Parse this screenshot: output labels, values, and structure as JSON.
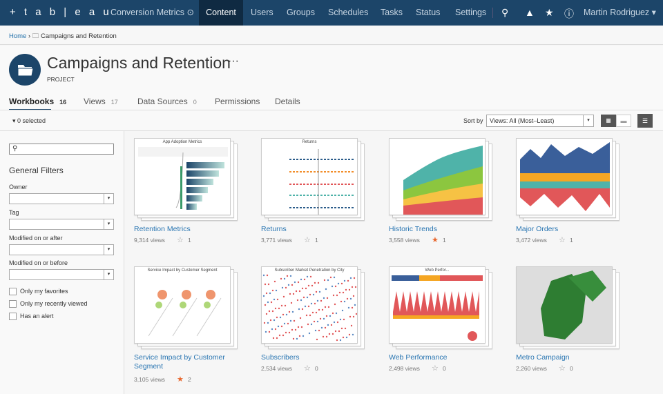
{
  "topbar": {
    "brand": "+ t a b | e a u",
    "site": "Conversion Metrics",
    "nav": [
      "Content",
      "Users",
      "Groups",
      "Schedules",
      "Tasks",
      "Status",
      "Settings"
    ],
    "active": "Content",
    "user": "Martin Rodriguez"
  },
  "breadcrumb": {
    "home": "Home",
    "current": "Campaigns and Retention"
  },
  "project": {
    "title": "Campaigns and Retention",
    "more": "···",
    "type": "PROJECT"
  },
  "tabs": [
    {
      "label": "Workbooks",
      "count": "16"
    },
    {
      "label": "Views",
      "count": "17"
    },
    {
      "label": "Data Sources",
      "count": "0"
    },
    {
      "label": "Permissions",
      "count": ""
    },
    {
      "label": "Details",
      "count": ""
    }
  ],
  "toolbar": {
    "selected": "0 selected",
    "sort_label": "Sort by",
    "sort_value": "Views: All (Most–Least)"
  },
  "filters": {
    "heading": "General Filters",
    "owner": "Owner",
    "tag": "Tag",
    "after": "Modified on or after",
    "before": "Modified on or before",
    "checks": [
      "Only my favorites",
      "Only my recently viewed",
      "Has an alert"
    ]
  },
  "workbooks": [
    {
      "title": "Retention Metrics",
      "views": "9,314 views",
      "favs": "1",
      "fav": false,
      "thumb_title": "App Adoption Metrics"
    },
    {
      "title": "Returns",
      "views": "3,771 views",
      "favs": "1",
      "fav": false,
      "thumb_title": "Returns"
    },
    {
      "title": "Historic Trends",
      "views": "3,558 views",
      "favs": "1",
      "fav": true,
      "thumb_title": ""
    },
    {
      "title": "Major Orders",
      "views": "3,472 views",
      "favs": "1",
      "fav": false,
      "thumb_title": ""
    },
    {
      "title": "Service Impact by Customer Segment",
      "views": "3,105 views",
      "favs": "2",
      "fav": true,
      "thumb_title": "Service Impact by Customer Segment"
    },
    {
      "title": "Subscribers",
      "views": "2,534 views",
      "favs": "0",
      "fav": false,
      "thumb_title": "Subscriber Market Penetration by City"
    },
    {
      "title": "Web Performance",
      "views": "2,498 views",
      "favs": "0",
      "fav": false,
      "thumb_title": "Web Perfor..."
    },
    {
      "title": "Metro Campaign",
      "views": "2,260 views",
      "favs": "0",
      "fav": false,
      "thumb_title": ""
    }
  ],
  "colors": {
    "header": "#1c4569",
    "link": "#2a76b2",
    "favorite": "#e8682f"
  }
}
